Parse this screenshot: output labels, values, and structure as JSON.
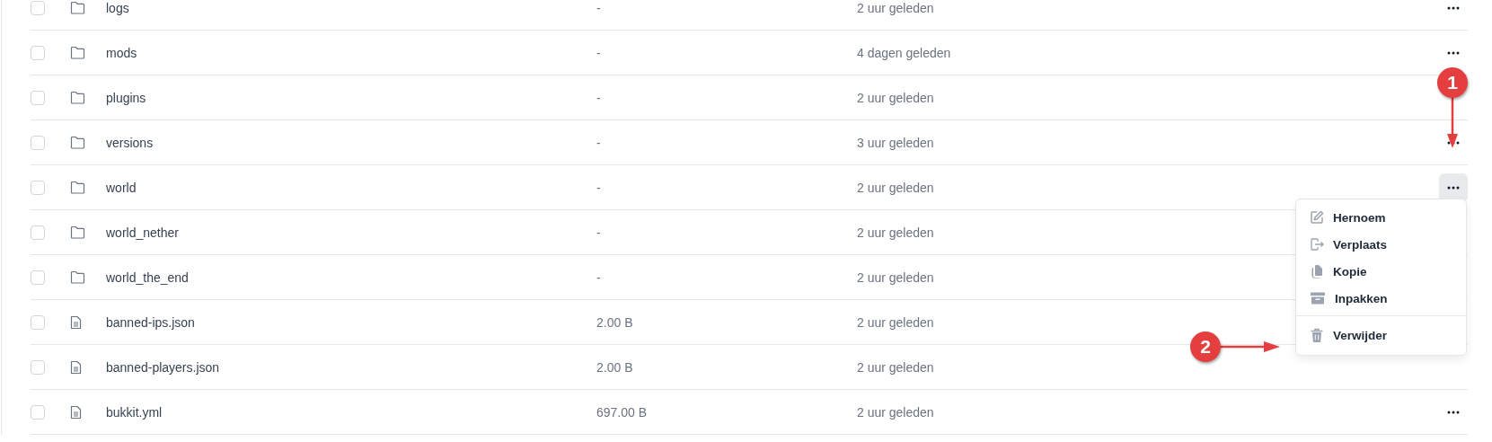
{
  "rows": [
    {
      "kind": "folder",
      "checked": false,
      "name": "logs",
      "size": "-",
      "modified": "2 uur geleden",
      "active": false,
      "actions_shown": true
    },
    {
      "kind": "folder",
      "checked": false,
      "name": "mods",
      "size": "-",
      "modified": "4 dagen geleden",
      "active": false,
      "actions_shown": true
    },
    {
      "kind": "folder",
      "checked": false,
      "name": "plugins",
      "size": "-",
      "modified": "2 uur geleden",
      "active": false,
      "actions_shown": false
    },
    {
      "kind": "folder",
      "checked": false,
      "name": "versions",
      "size": "-",
      "modified": "3 uur geleden",
      "active": false,
      "actions_shown": true
    },
    {
      "kind": "folder",
      "checked": false,
      "name": "world",
      "size": "-",
      "modified": "2 uur geleden",
      "active": true,
      "actions_shown": true
    },
    {
      "kind": "folder",
      "checked": false,
      "name": "world_nether",
      "size": "-",
      "modified": "2 uur geleden",
      "active": false,
      "actions_shown": false
    },
    {
      "kind": "folder",
      "checked": false,
      "name": "world_the_end",
      "size": "-",
      "modified": "2 uur geleden",
      "active": false,
      "actions_shown": false
    },
    {
      "kind": "file",
      "checked": false,
      "name": "banned-ips.json",
      "size": "2.00 B",
      "modified": "2 uur geleden",
      "active": false,
      "actions_shown": false
    },
    {
      "kind": "file",
      "checked": false,
      "name": "banned-players.json",
      "size": "2.00 B",
      "modified": "2 uur geleden",
      "active": false,
      "actions_shown": false
    },
    {
      "kind": "file",
      "checked": false,
      "name": "bukkit.yml",
      "size": "697.00 B",
      "modified": "2 uur geleden",
      "active": false,
      "actions_shown": true
    }
  ],
  "context_menu": {
    "items": [
      {
        "kind": "rename",
        "label": "Hernoem"
      },
      {
        "kind": "move",
        "label": "Verplaats"
      },
      {
        "kind": "copy",
        "label": "Kopie"
      },
      {
        "kind": "archive",
        "label": "Inpakken"
      },
      {
        "kind": "delete",
        "label": "Verwijder"
      }
    ]
  },
  "annotations": [
    {
      "label": "1",
      "kind": "down"
    },
    {
      "label": "2",
      "kind": "right"
    }
  ]
}
